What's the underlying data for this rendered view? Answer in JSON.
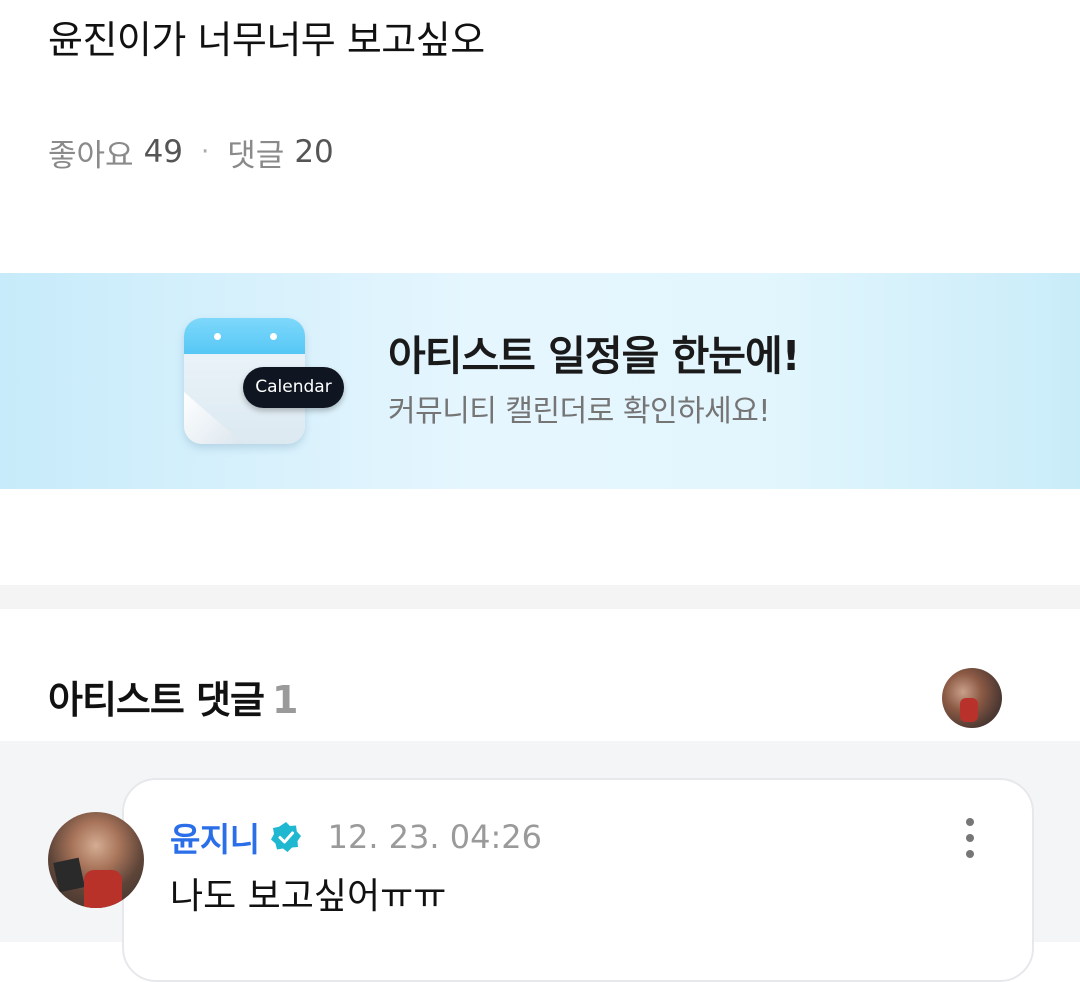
{
  "post": {
    "title": "윤진이가 너무너무 보고싶오",
    "likes_label": "좋아요",
    "likes_count": "49",
    "separator": "·",
    "comments_label": "댓글",
    "comments_count": "20"
  },
  "banner": {
    "tag": "Calendar",
    "title": "아티스트 일정을 한눈에!",
    "subtitle": "커뮤니티 캘린더로 확인하세요!"
  },
  "artist_comments": {
    "title": "아티스트 댓글",
    "count": "1"
  },
  "comment": {
    "author": "윤지니",
    "timestamp": "12. 23. 04:26",
    "text": "나도 보고싶어ㅠㅠ"
  },
  "colors": {
    "accent": "#2a6ee8",
    "verified": "#1fb8d0",
    "banner_bg": "#d9f2fc",
    "calendar_tag": "#0f1622"
  },
  "icons": {
    "verified": "verified-badge-icon",
    "more": "more-vertical-icon",
    "calendar": "calendar-icon"
  }
}
